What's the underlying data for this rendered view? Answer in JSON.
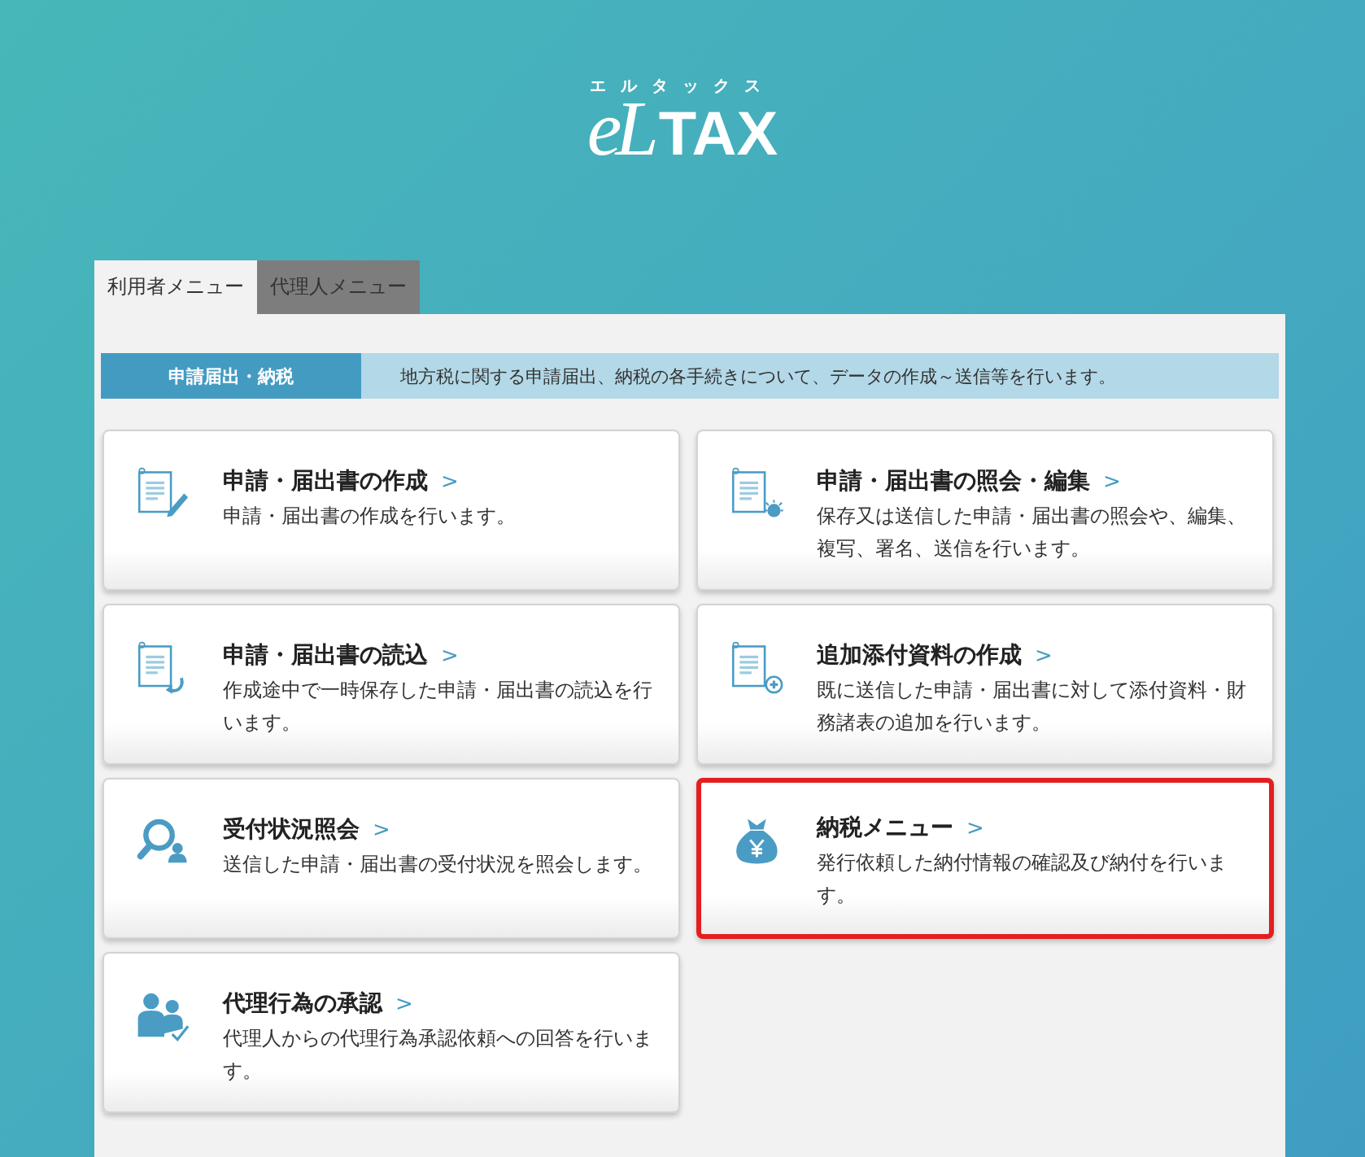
{
  "logo": {
    "reading": "エルタックス",
    "script_part": "eL",
    "block_part": "TAX"
  },
  "tabs": [
    {
      "label": "利用者メニュー",
      "selected": true
    },
    {
      "label": "代理人メニュー",
      "selected": false
    }
  ],
  "section": {
    "label": "申請届出・納税",
    "description": "地方税に関する申請届出、納税の各手続きについて、データの作成～送信等を行います。"
  },
  "cards": [
    {
      "kind": "create",
      "title": "申請・届出書の作成",
      "arrow": ">",
      "description": "申請・届出書の作成を行います。",
      "selected": false
    },
    {
      "kind": "view",
      "title": "申請・届出書の照会・編集",
      "arrow": ">",
      "description": "保存又は送信した申請・届出書の照会や、編集、複写、署名、送信を行います。",
      "selected": false
    },
    {
      "kind": "load",
      "title": "申請・届出書の読込",
      "arrow": ">",
      "description": "作成途中で一時保存した申請・届出書の読込を行います。",
      "selected": false
    },
    {
      "kind": "attach",
      "title": "追加添付資料の作成",
      "arrow": ">",
      "description": "既に送信した申請・届出書に対して添付資料・財務諸表の追加を行います。",
      "selected": false
    },
    {
      "kind": "search",
      "title": "受付状況照会",
      "arrow": ">",
      "description": "送信した申請・届出書の受付状況を照会します。",
      "selected": false
    },
    {
      "kind": "payment",
      "title": "納税メニュー",
      "arrow": ">",
      "description": "発行依頼した納付情報の確認及び納付を行います。",
      "selected": true
    },
    {
      "kind": "approve",
      "title": "代理行為の承認",
      "arrow": ">",
      "description": "代理人からの代理行為承認依頼への回答を行います。",
      "selected": false
    }
  ]
}
